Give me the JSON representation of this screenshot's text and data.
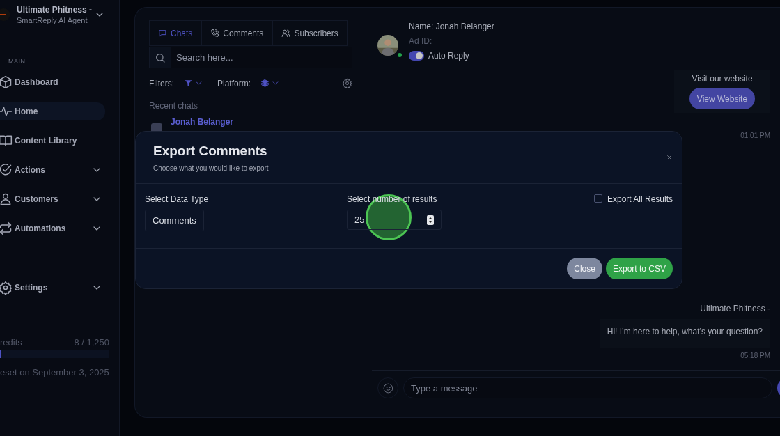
{
  "workspace": {
    "name": "Ultimate Phitness -",
    "subtitle": "SmartReply AI Agent"
  },
  "sidebar": {
    "section": "MAIN",
    "items": [
      {
        "label": "Dashboard",
        "selected": false,
        "expandable": false
      },
      {
        "label": "Home",
        "selected": true,
        "expandable": false
      },
      {
        "label": "Content Library",
        "selected": false,
        "expandable": false
      },
      {
        "label": "Actions",
        "selected": false,
        "expandable": true
      },
      {
        "label": "Customers",
        "selected": false,
        "expandable": true
      },
      {
        "label": "Automations",
        "selected": false,
        "expandable": true
      }
    ],
    "bottom_items": [
      {
        "label": "Settings",
        "selected": false,
        "expandable": true
      }
    ]
  },
  "credits": {
    "label": "redits",
    "count": "8 / 1,250",
    "level": 0.01,
    "reset": "eset on September 3, 2025"
  },
  "chat_list": {
    "tabs": [
      {
        "label": "Chats",
        "selected": true
      },
      {
        "label": "Comments",
        "selected": false
      },
      {
        "label": "Subscribers",
        "selected": false
      }
    ],
    "search": {
      "placeholder": "Search here..."
    },
    "filters_label": "Filters:",
    "platform_label": "Platform:",
    "recent_label": "Recent chats",
    "chats": [
      {
        "name": "Jonah Belanger"
      }
    ]
  },
  "conversation": {
    "name": "Name: Jonah Belanger",
    "ad_id": "Ad ID:",
    "online": true,
    "auto_reply": {
      "label": "Auto Reply",
      "on": true
    },
    "card": {
      "text": "Visit our website",
      "button": "View Website",
      "time": "01:01 PM"
    },
    "messages": [
      {
        "sender": "Ultimate Phitness -",
        "text": "Hi! I’m here to help, what’s your question?",
        "time": "05:18 PM"
      }
    ],
    "composer": {
      "placeholder": "Type a message"
    }
  },
  "modal": {
    "title": "Export Comments",
    "subtitle": "Choose what you would like to export",
    "data_type_label": "Select Data Type",
    "data_type_value": "Comments",
    "count_label": "Select number of results",
    "count_value": "25",
    "export_all": {
      "label": "Export All Results",
      "checked": false
    },
    "buttons": [
      {
        "label": "Close",
        "kind": "secondary"
      },
      {
        "label": "Export to CSV",
        "kind": "primary"
      }
    ]
  }
}
